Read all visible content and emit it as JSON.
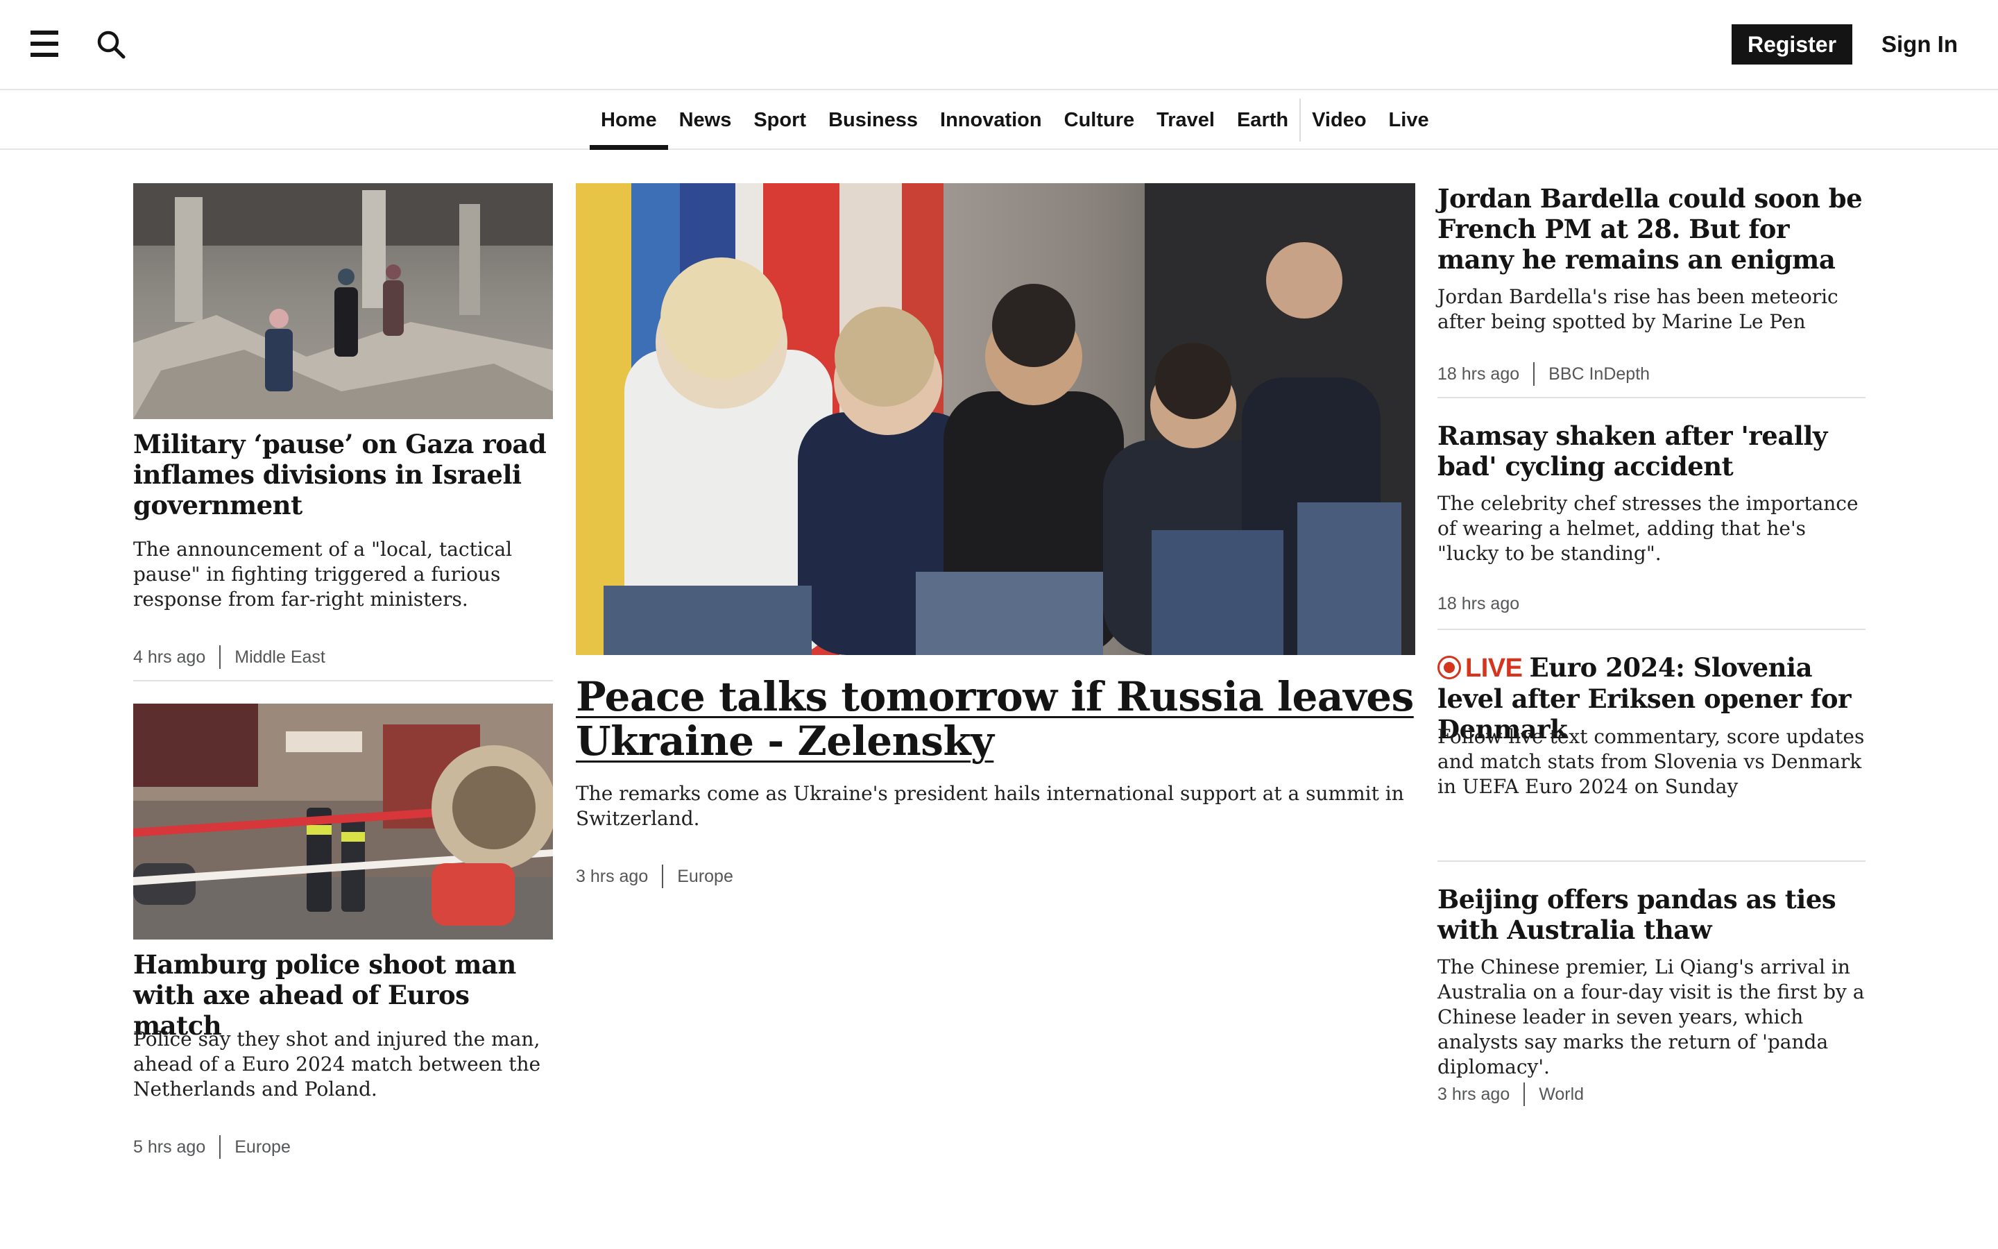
{
  "header": {
    "menu_icon": "hamburger-menu-icon",
    "search_icon": "search-icon",
    "register_label": "Register",
    "signin_label": "Sign In"
  },
  "nav": {
    "items": [
      "Home",
      "News",
      "Sport",
      "Business",
      "Innovation",
      "Culture",
      "Travel",
      "Earth",
      "Video",
      "Live"
    ],
    "active": "Home"
  },
  "colors": {
    "text": "#141414",
    "live_red": "#d4351c",
    "meta_grey": "#545658",
    "divider": "#e0e0e0"
  },
  "stories": {
    "left": [
      {
        "headline": "Military ‘pause’ on Gaza road inflames divisions in Israeli government",
        "summary": "The announcement of a \"local, tactical pause\" in fighting triggered a furious response from far-right ministers.",
        "time": "4 hrs ago",
        "section": "Middle East",
        "image": "gaza-rubble-photo"
      },
      {
        "headline": "Hamburg police shoot man with axe ahead of Euros match",
        "summary": "Police say they shot and injured the man, ahead of a Euro 2024 match between the Netherlands and Poland.",
        "time": "5 hrs ago",
        "section": "Europe",
        "image": "hamburg-police-photo"
      }
    ],
    "main": {
      "headline": "Peace talks tomorrow if Russia leaves Ukraine - Zelensky",
      "summary": "The remarks come as Ukraine's president hails international support at a summit in Switzerland.",
      "time": "3 hrs ago",
      "section": "Europe",
      "image": "peace-summit-press-conference-photo"
    },
    "right": [
      {
        "headline": "Jordan Bardella could soon be French PM at 28. But for many he remains an enigma",
        "summary": "Jordan Bardella's rise has been meteoric after being spotted by Marine Le Pen",
        "time": "18 hrs ago",
        "section": "BBC InDepth"
      },
      {
        "headline": "Ramsay shaken after 'really bad' cycling accident",
        "summary": "The celebrity chef stresses the importance of wearing a helmet, adding that he's \"lucky to be standing\".",
        "time": "18 hrs ago"
      },
      {
        "live_label": "LIVE",
        "headline": "Euro 2024: Slovenia level after Eriksen opener for Denmark",
        "summary": "Follow live text commentary, score updates and match stats from Slovenia vs Denmark in UEFA Euro 2024 on Sunday"
      },
      {
        "headline": "Beijing offers pandas as ties with Australia thaw",
        "summary": "The Chinese premier, Li Qiang's arrival in Australia on a four-day visit is the first by a Chinese leader in seven years, which analysts say marks the return of 'panda diplomacy'.",
        "time": "3 hrs ago",
        "section": "World"
      }
    ]
  }
}
